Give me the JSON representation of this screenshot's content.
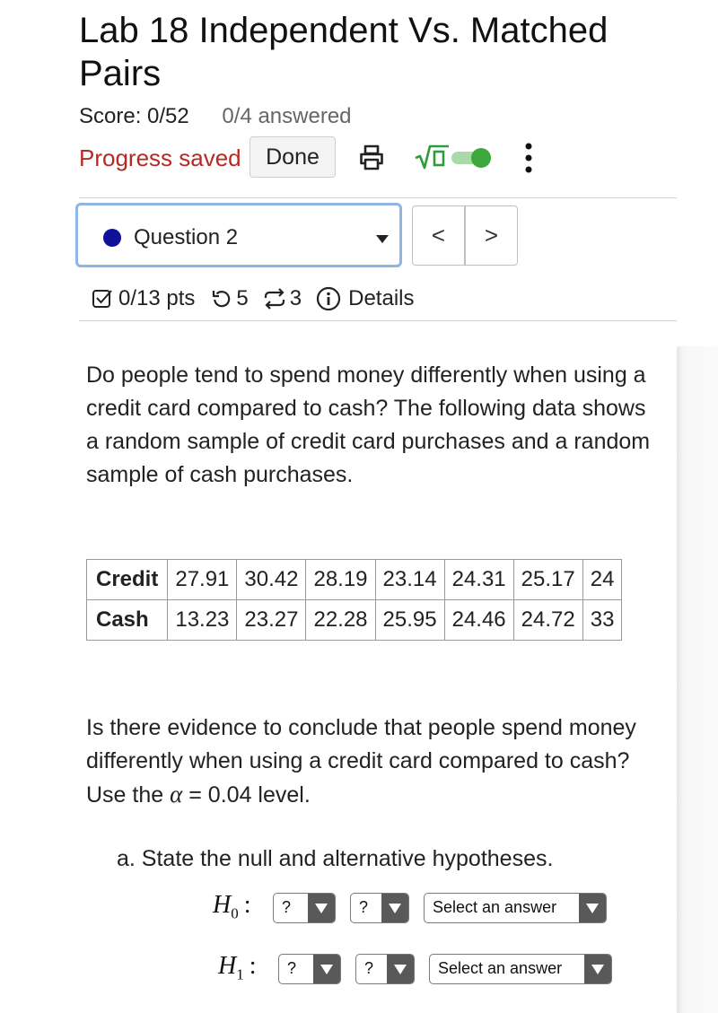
{
  "header": {
    "title": "Lab 18 Independent Vs. Matched Pairs",
    "score": "Score: 0/52",
    "answered": "0/4 answered",
    "progress_status": "Progress saved",
    "done_label": "Done"
  },
  "toggle": {
    "state": "on",
    "color": "#3aa83a"
  },
  "question_nav": {
    "selected": "Question 2",
    "prev_label": "<",
    "next_label": ">"
  },
  "question_meta": {
    "points": "0/13 pts",
    "attempts": "5",
    "tries": "3",
    "details_label": "Details"
  },
  "question": {
    "intro": "Do people tend to spend money differently when using a credit card compared to cash? The following data shows a random sample of credit card purchases and a random sample of cash purchases.",
    "table": {
      "rows": [
        {
          "label": "Credit",
          "values": [
            "27.91",
            "30.42",
            "28.19",
            "23.14",
            "24.31",
            "25.17",
            "24"
          ]
        },
        {
          "label": "Cash",
          "values": [
            "13.23",
            "23.27",
            "22.28",
            "25.95",
            "24.46",
            "24.72",
            "33"
          ]
        }
      ]
    },
    "evidence_prefix": "Is there evidence to conclude that people spend money differently when using a credit card compared to cash? Use the",
    "alpha_symbol": "α",
    "alpha_suffix": "= 0.04 level.",
    "part_a": "a. State the null and alternative hypotheses.",
    "h0": {
      "symbol": "H",
      "sub": "0",
      "select1": "?",
      "select2": "?",
      "select3": "Select an answer"
    },
    "h1": {
      "symbol": "H",
      "sub": "1",
      "select1": "?",
      "select2": "?",
      "select3": "Select an answer"
    }
  }
}
